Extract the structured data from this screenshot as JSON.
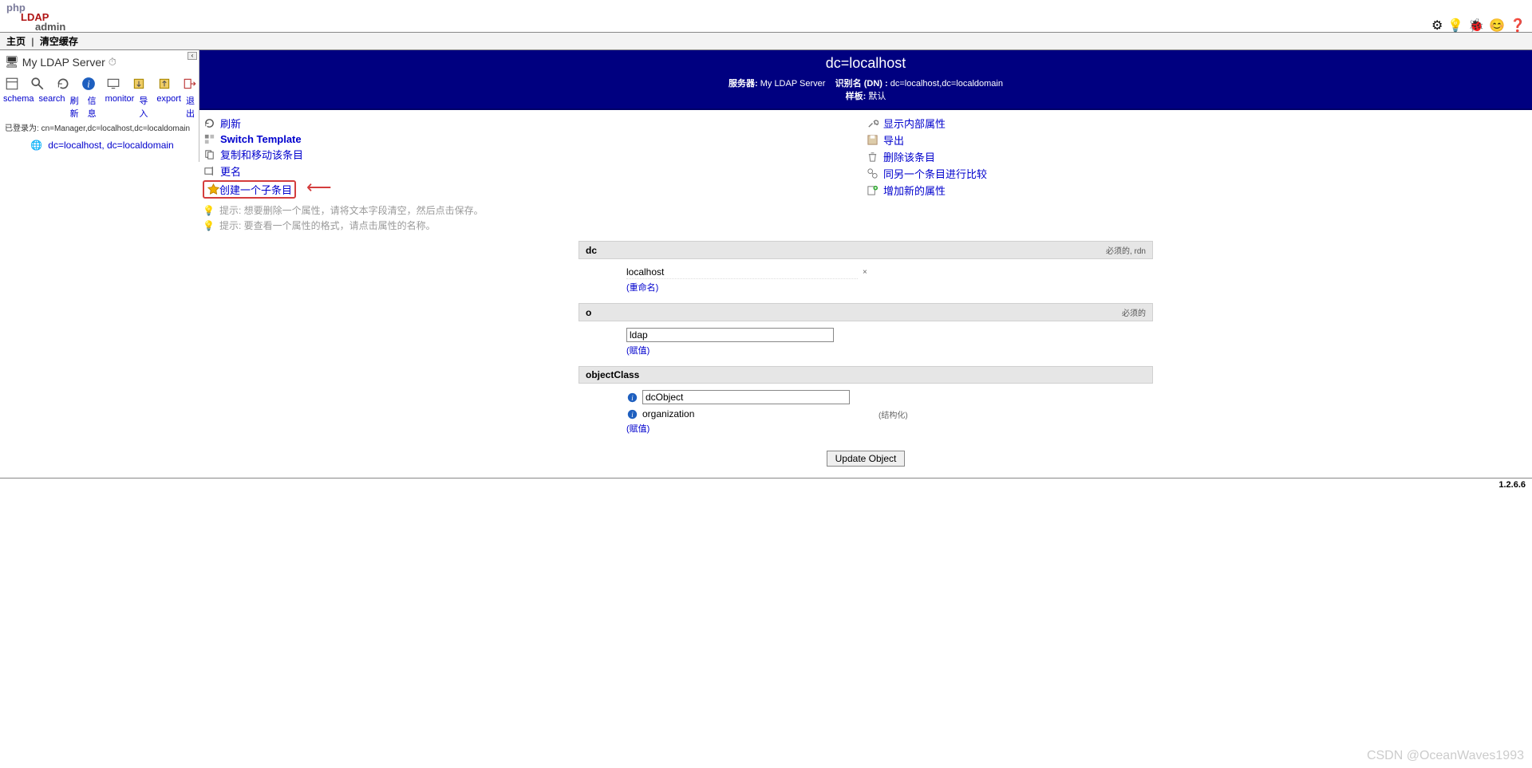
{
  "logo": {
    "l1": "php",
    "l2": "LDAP",
    "l3": "admin"
  },
  "menubar": {
    "home": "主页",
    "purge": "清空缓存"
  },
  "top_icons": [
    "⚙",
    "💡",
    "🐞",
    "😊",
    "❓"
  ],
  "sidebar": {
    "server_name": "My LDAP Server",
    "toolbar": [
      {
        "name": "schema-icon",
        "label": "schema"
      },
      {
        "name": "search-icon",
        "label": "search"
      },
      {
        "name": "refresh-icon",
        "label": "刷新"
      },
      {
        "name": "info-icon",
        "label": "信息"
      },
      {
        "name": "monitor-icon",
        "label": "monitor"
      },
      {
        "name": "import-icon",
        "label": "导入"
      },
      {
        "name": "export-icon",
        "label": "export"
      },
      {
        "name": "logout-icon",
        "label": "退出"
      }
    ],
    "logged_as_prefix": "已登录为: ",
    "logged_as_dn": "cn=Manager,dc=localhost,dc=localdomain",
    "tree_entry": "dc=localhost, dc=localdomain"
  },
  "header": {
    "title": "dc=localhost",
    "server_label": "服务器:",
    "server_value": "My LDAP Server",
    "dn_label": "识别名 (DN) :",
    "dn_value": "dc=localhost,dc=localdomain",
    "template_label": "样板:",
    "template_value": "默认"
  },
  "actions_left": [
    {
      "name": "refresh-action",
      "label": "刷新",
      "icon": "refresh"
    },
    {
      "name": "switch-template-action",
      "label": "Switch Template",
      "icon": "template",
      "bold": true
    },
    {
      "name": "copy-move-action",
      "label": "复制和移动该条目",
      "icon": "copy"
    },
    {
      "name": "rename-action",
      "label": "更名",
      "icon": "rename"
    },
    {
      "name": "create-child-action",
      "label": "创建一个子条目",
      "icon": "star",
      "highlight": true
    }
  ],
  "actions_right": [
    {
      "name": "show-internal-action",
      "label": "显示内部属性",
      "icon": "tools"
    },
    {
      "name": "export-action",
      "label": "导出",
      "icon": "save"
    },
    {
      "name": "delete-action",
      "label": "删除该条目",
      "icon": "trash"
    },
    {
      "name": "compare-action",
      "label": "同另一个条目进行比较",
      "icon": "compare"
    },
    {
      "name": "add-attr-action",
      "label": "增加新的属性",
      "icon": "add"
    }
  ],
  "hints": [
    "提示:   想要删除一个属性，请将文本字段清空，然后点击保存。",
    "提示:   要查看一个属性的格式，请点击属性的名称。"
  ],
  "attrs": {
    "dc": {
      "label": "dc",
      "req": "必须的, rdn",
      "value": "localhost",
      "rename": "(重命名)"
    },
    "o": {
      "label": "o",
      "req": "必须的",
      "value": "ldap",
      "addval": "(赋值)"
    },
    "oc": {
      "label": "objectClass",
      "v1": "dcObject",
      "v2": "organization",
      "struct": "(结构化)",
      "addval": "(赋值)"
    }
  },
  "submit": "Update Object",
  "version": "1.2.6.6",
  "watermark": "CSDN @OceanWaves1993"
}
